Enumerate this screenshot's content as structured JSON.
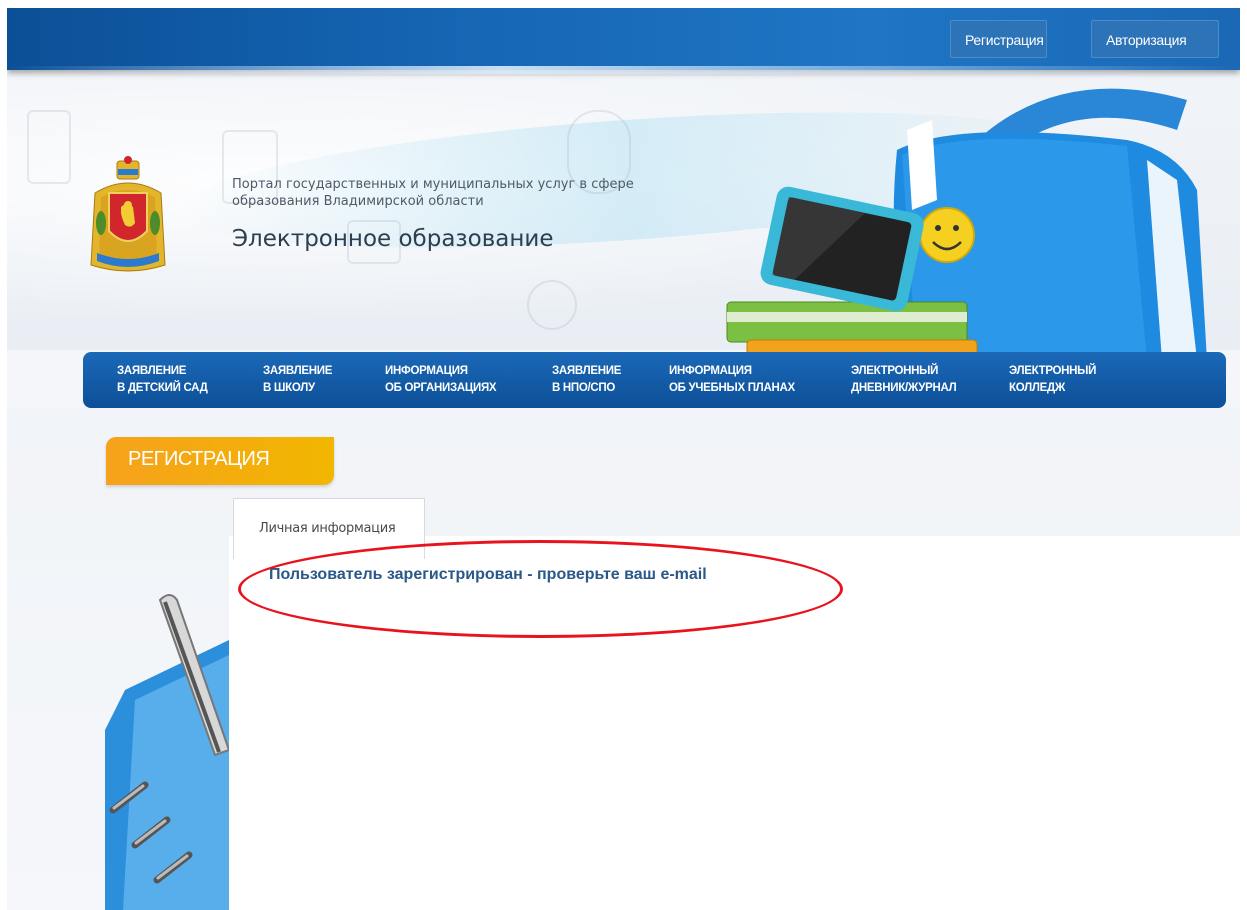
{
  "topbar": {
    "register_label": "Регистрация",
    "login_label": "Авторизация"
  },
  "header": {
    "subtitle_line1": "Портал государственных и муниципальных услуг в сфере",
    "subtitle_line2": "образования Владимирской области",
    "title": "Электронное образование"
  },
  "nav": {
    "items": [
      {
        "line1": "Заявление",
        "line2": "в детский сад"
      },
      {
        "line1": "Заявление",
        "line2": "в школу"
      },
      {
        "line1": "Информация",
        "line2": "об организациях"
      },
      {
        "line1": "Заявление",
        "line2": "в НПО/СПО"
      },
      {
        "line1": "Информация",
        "line2": "об учебных планах"
      },
      {
        "line1": "Электронный",
        "line2": "дневник/журнал"
      },
      {
        "line1": "Электронный",
        "line2": "колледж"
      }
    ]
  },
  "main": {
    "section_title": "РЕГИСТРАЦИЯ",
    "form_tab_label": "Личная информация",
    "message": "Пользователь зарегистрирован - проверьте ваш e-mail"
  },
  "colors": {
    "topbar": "#1565b3",
    "nav": "#0d4f98",
    "section_tab": "#f6a21c",
    "message": "#2a5888",
    "highlight": "#e8131d"
  }
}
